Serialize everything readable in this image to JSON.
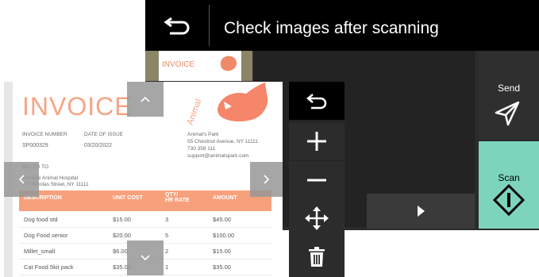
{
  "header": {
    "title": "Check images after scanning"
  },
  "thumbnail": {
    "title": "INVOICE"
  },
  "actions": {
    "send_label": "Send",
    "scan_label": "Scan"
  },
  "tools": [
    "back",
    "zoom-in",
    "zoom-out",
    "move",
    "delete"
  ],
  "invoice": {
    "title": "INVOICE",
    "invoice_number_label": "INVOICE NUMBER",
    "invoice_number": "SP000329",
    "date_label": "DATE OF ISSUE",
    "date": "03/20/2022",
    "from_name": "Animal's Park",
    "from_address": "55 Chestnut Avenue, NY 11111",
    "from_phone": "730 358 111",
    "from_email": "support@animalspark.com",
    "billed_to_label": "BILLED TO",
    "billed_to_name": "Seaside Animal Hospital",
    "billed_to_address": "777 Nicolas Street, NY 11111",
    "logo_text": "Animal",
    "columns": [
      "DESCRIPTION",
      "UNIT COST",
      "QTY/\nHR RATE",
      "AMOUNT"
    ],
    "rows": [
      [
        "Dog food std",
        "$15.00",
        "3",
        "$45.00"
      ],
      [
        "Dog Food senior",
        "$20.00",
        "5",
        "$100.00"
      ],
      [
        "Millet_small",
        "$6.00",
        "2",
        "$15.00"
      ],
      [
        "Cat Food 5kit pack",
        "$35.00",
        "1",
        "$35.00"
      ]
    ]
  },
  "colors": {
    "accent": "#7dd4bd",
    "invoice_orange": "#f5a585"
  }
}
